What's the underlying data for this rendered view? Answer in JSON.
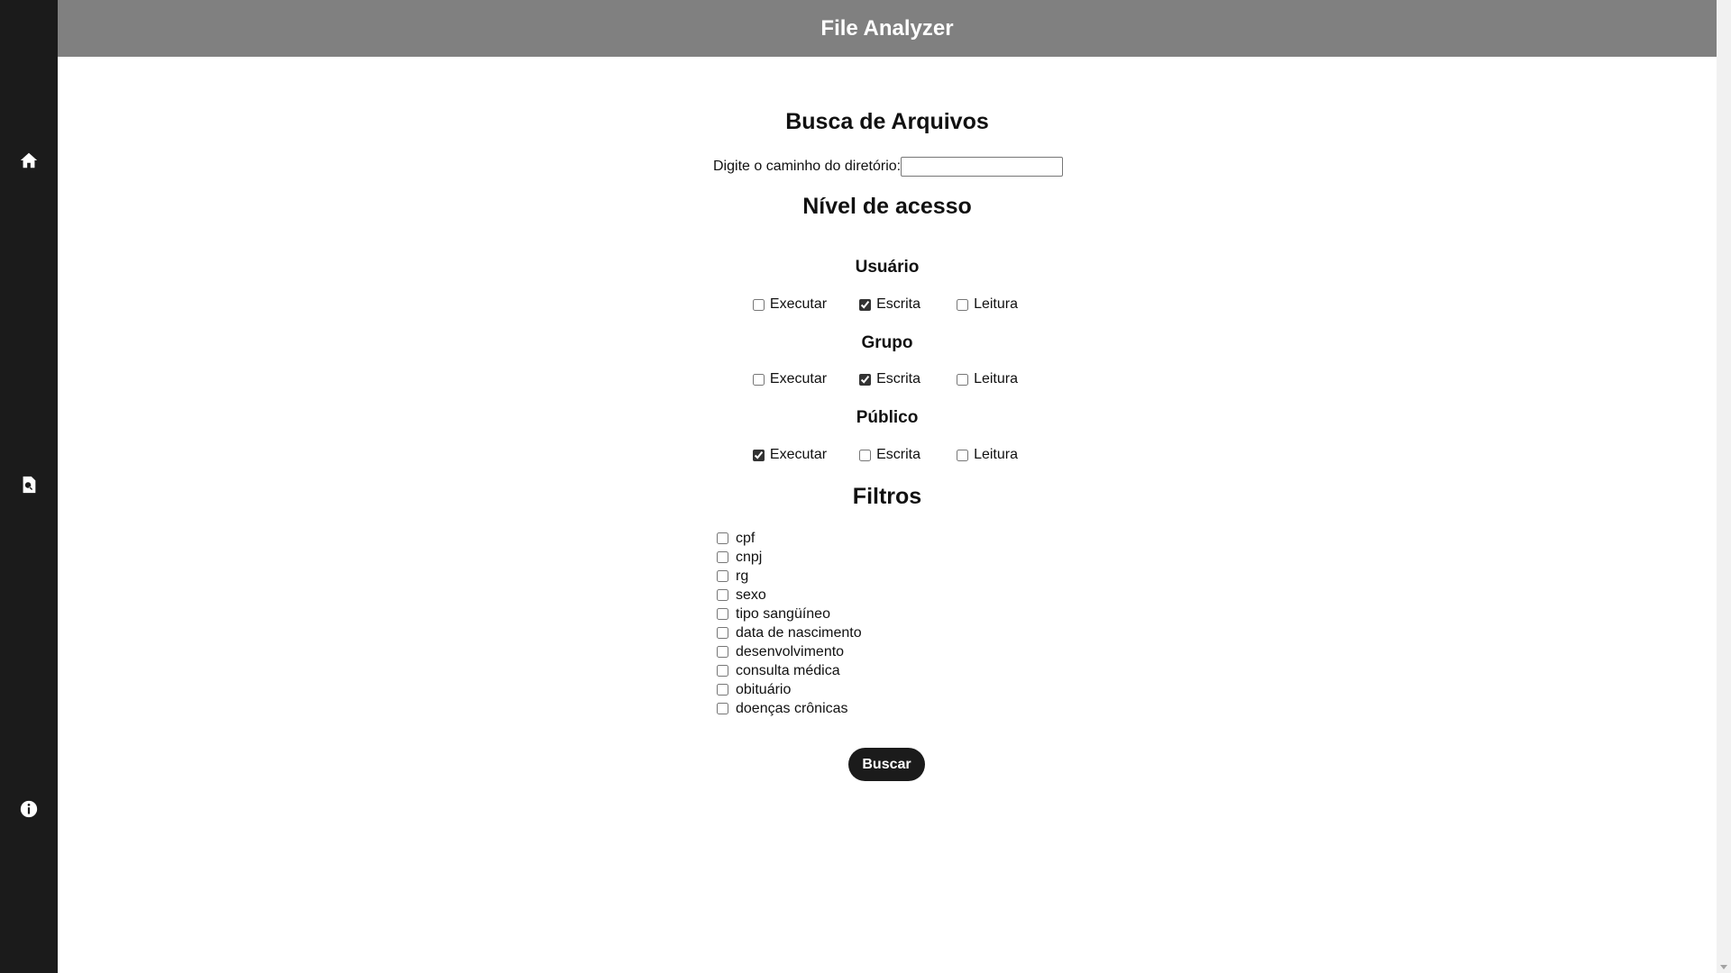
{
  "header": {
    "title": "File Analyzer"
  },
  "sidebar": {
    "items": [
      {
        "icon": "home-icon"
      },
      {
        "icon": "file-search-icon"
      },
      {
        "icon": "info-icon"
      }
    ]
  },
  "search": {
    "title": "Busca de Arquivos",
    "path_label": "Digite o caminho do diretório:",
    "path_value": ""
  },
  "access": {
    "title": "Nível de acesso",
    "groups": [
      {
        "label": "Usuário",
        "executar": false,
        "escrita": true,
        "leitura": false
      },
      {
        "label": "Grupo",
        "executar": false,
        "escrita": true,
        "leitura": false
      },
      {
        "label": "Público",
        "executar": true,
        "escrita": false,
        "leitura": false
      }
    ],
    "perm_labels": {
      "executar": "Executar",
      "escrita": "Escrita",
      "leitura": "Leitura"
    }
  },
  "filters": {
    "title": "Filtros",
    "items": [
      {
        "label": "cpf",
        "checked": false
      },
      {
        "label": "cnpj",
        "checked": false
      },
      {
        "label": "rg",
        "checked": false
      },
      {
        "label": "sexo",
        "checked": false
      },
      {
        "label": "tipo sangüíneo",
        "checked": false
      },
      {
        "label": "data de nascimento",
        "checked": false
      },
      {
        "label": "desenvolvimento",
        "checked": false
      },
      {
        "label": "consulta médica",
        "checked": false
      },
      {
        "label": "obituário",
        "checked": false
      },
      {
        "label": "doenças crônicas",
        "checked": false
      }
    ]
  },
  "actions": {
    "buscar_label": "Buscar"
  },
  "colors": {
    "sidebar": "#1b1b1b",
    "header": "#808080",
    "button": "#1b1b1b"
  }
}
